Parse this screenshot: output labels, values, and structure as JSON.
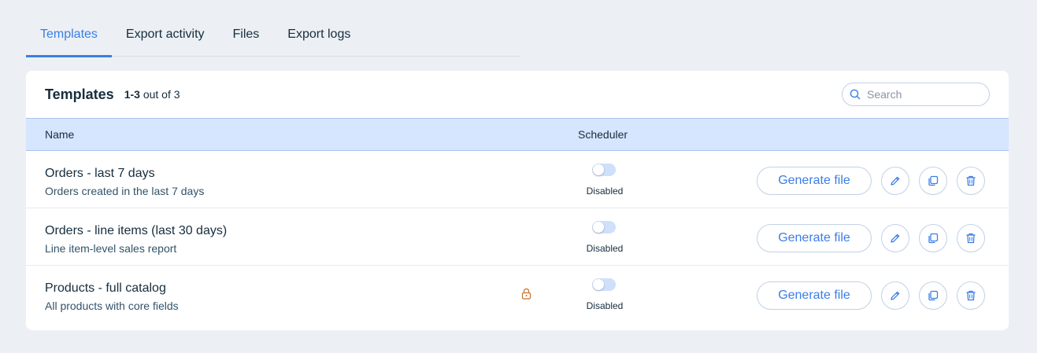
{
  "tabs": [
    {
      "label": "Templates",
      "active": true
    },
    {
      "label": "Export activity",
      "active": false
    },
    {
      "label": "Files",
      "active": false
    },
    {
      "label": "Export logs",
      "active": false
    }
  ],
  "card": {
    "title": "Templates",
    "count_range": "1-3",
    "count_suffix": "out of 3",
    "search_placeholder": "Search"
  },
  "table": {
    "columns": {
      "name": "Name",
      "scheduler": "Scheduler"
    },
    "rows": [
      {
        "title": "Orders - last 7 days",
        "description": "Orders created in the last 7 days",
        "locked": false,
        "scheduler_status": "Disabled",
        "scheduler_enabled": false,
        "action_label": "Generate file"
      },
      {
        "title": "Orders - line items (last 30 days)",
        "description": "Line item-level sales report",
        "locked": false,
        "scheduler_status": "Disabled",
        "scheduler_enabled": false,
        "action_label": "Generate file"
      },
      {
        "title": "Products - full catalog",
        "description": "All products with core fields",
        "locked": true,
        "scheduler_status": "Disabled",
        "scheduler_enabled": false,
        "action_label": "Generate file"
      }
    ]
  },
  "colors": {
    "accent": "#3b7de6",
    "header_bg": "#d6e6fe",
    "page_bg": "#ecf0f5",
    "lock": "#c5702a"
  },
  "icons": {
    "search": "search-icon",
    "lock": "lock-icon",
    "edit": "pencil-icon",
    "duplicate": "duplicate-icon",
    "delete": "trash-icon"
  }
}
